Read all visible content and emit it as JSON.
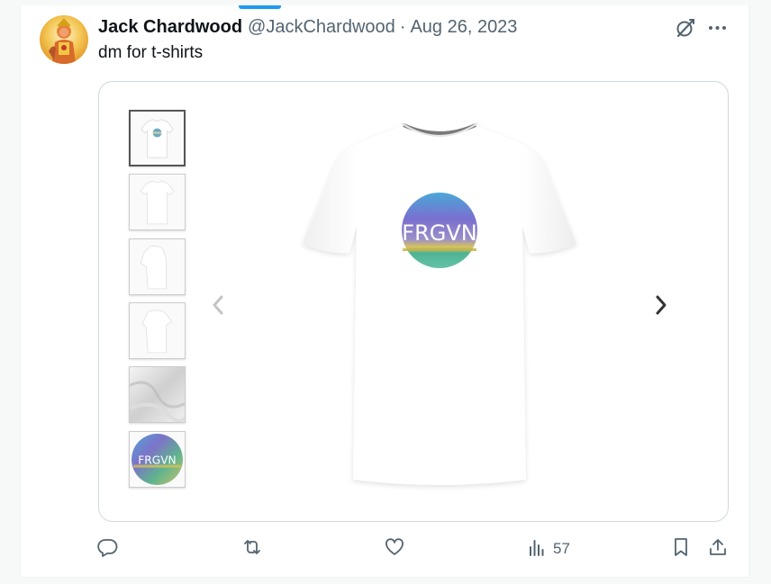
{
  "tweet": {
    "display_name": "Jack Chardwood",
    "handle": "@JackChardwood",
    "separator": "·",
    "date": "Aug 26, 2023",
    "text": "dm for t-shirts"
  },
  "media": {
    "logo_text": "FRGVN",
    "thumbnails": [
      "front-with-logo",
      "front-plain",
      "side",
      "back",
      "fabric-closeup",
      "logo-print"
    ],
    "active_thumbnail": 0
  },
  "actions": {
    "reply_count": "",
    "retweet_count": "",
    "like_count": "",
    "views_count": "57"
  },
  "colors": {
    "accent": "#1d9bf0",
    "text_primary": "#0f1419",
    "text_secondary": "#536471",
    "border": "#cfd9de"
  },
  "icons": {
    "grok": "grok-icon",
    "more": "more-icon",
    "reply": "reply-icon",
    "retweet": "retweet-icon",
    "like": "like-icon",
    "views": "views-icon",
    "bookmark": "bookmark-icon",
    "share": "share-icon"
  }
}
